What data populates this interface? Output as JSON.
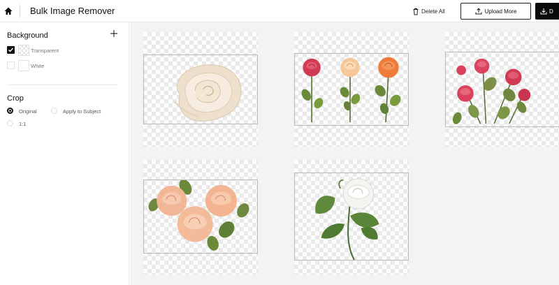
{
  "header": {
    "home_icon": "home-icon",
    "title": "Bulk Image Remover",
    "delete_all_label": "Delete All",
    "upload_more_label": "Upload More",
    "download_label": "D"
  },
  "sidebar": {
    "background": {
      "title": "Background",
      "options": [
        {
          "label": "Transparent",
          "checked": true
        },
        {
          "label": "White",
          "checked": false
        }
      ]
    },
    "crop": {
      "title": "Crop",
      "options": [
        {
          "label": "Original",
          "selected": true
        },
        {
          "label": "Apply to Subject",
          "selected": false
        },
        {
          "label": "1:1",
          "selected": false
        }
      ]
    }
  },
  "gallery": {
    "images": [
      {
        "subject": "single cream rose"
      },
      {
        "subject": "three roses red peach orange"
      },
      {
        "subject": "pink rose branches"
      },
      {
        "subject": "peach rose cluster"
      },
      {
        "subject": "white rose with leaves"
      }
    ]
  },
  "colors": {
    "accent": "#0a0a0a",
    "gallery_bg": "#f1f3f4",
    "checker": "#e9e9e9"
  }
}
